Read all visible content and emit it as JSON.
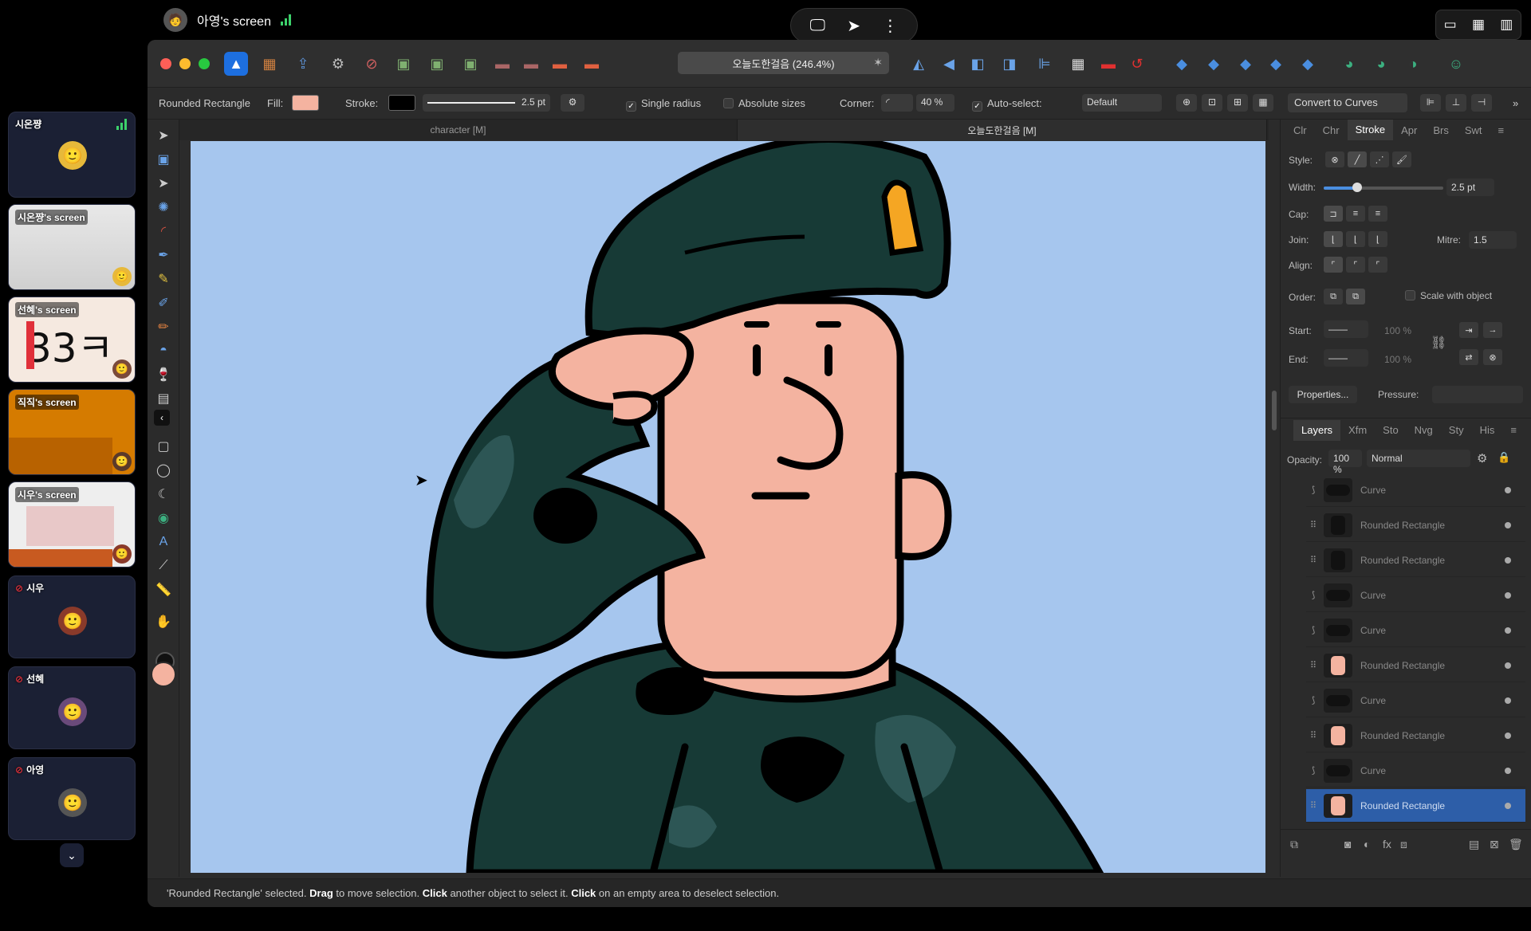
{
  "presenter": {
    "name": "아영's screen"
  },
  "share_controls": {
    "screen_icon": "monitor-icon",
    "pointer_icon": "cursor-icon",
    "more_icon": "more-vertical-icon"
  },
  "participants": [
    {
      "name": "시온쨩",
      "kind": "avatar"
    },
    {
      "name": "시온쨩's screen",
      "kind": "screen"
    },
    {
      "name": "선혜's screen",
      "kind": "screen",
      "screen_text": "33ㅋ"
    },
    {
      "name": "직직's screen",
      "kind": "screen"
    },
    {
      "name": "시우's screen",
      "kind": "screen"
    },
    {
      "name": "시우",
      "kind": "avatar",
      "muted": true
    },
    {
      "name": "선혜",
      "kind": "avatar",
      "muted": true
    },
    {
      "name": "아영",
      "kind": "avatar",
      "muted": true
    }
  ],
  "app": {
    "document_title": "오늘도한걸음 (246.4%)",
    "context": {
      "shape_name": "Rounded Rectangle",
      "fill_label": "Fill:",
      "fill_color": "#f4b3a0",
      "stroke_label": "Stroke:",
      "stroke_color": "#000000",
      "stroke_width": "2.5 pt",
      "single_radius": "Single radius",
      "absolute_sizes": "Absolute sizes",
      "corner_label": "Corner:",
      "corner_value": "40 %",
      "auto_select": "Auto-select:",
      "auto_select_value": "Default",
      "convert": "Convert to Curves"
    },
    "doc_tabs": [
      "character [M]",
      "오늘도한걸음 [M]"
    ],
    "stroke_panel": {
      "tabs": [
        "Clr",
        "Chr",
        "Stroke",
        "Apr",
        "Brs",
        "Swt"
      ],
      "active_tab": "Stroke",
      "style_label": "Style:",
      "width_label": "Width:",
      "width_value": "2.5 pt",
      "width_fraction": 0.28,
      "cap_label": "Cap:",
      "join_label": "Join:",
      "mitre_label": "Mitre:",
      "mitre_value": "1.5",
      "align_label": "Align:",
      "order_label": "Order:",
      "scale_with_object": "Scale with object",
      "start_label": "Start:",
      "end_label": "End:",
      "start_pct": "100 %",
      "end_pct": "100 %",
      "properties": "Properties...",
      "pressure": "Pressure:"
    },
    "layers_panel": {
      "tabs": [
        "Layers",
        "Xfm",
        "Sto",
        "Nvg",
        "Sty",
        "His"
      ],
      "active_tab": "Layers",
      "opacity_label": "Opacity:",
      "opacity_value": "100 %",
      "blend_mode": "Normal",
      "layers": [
        {
          "name": "Curve",
          "type": "curve",
          "thumb_color": "#111111"
        },
        {
          "name": "Rounded Rectangle",
          "type": "rect",
          "thumb_color": "#111111"
        },
        {
          "name": "Rounded Rectangle",
          "type": "rect",
          "thumb_color": "#111111"
        },
        {
          "name": "Curve",
          "type": "curve",
          "thumb_color": "#111111"
        },
        {
          "name": "Curve",
          "type": "curve",
          "thumb_color": "#111111"
        },
        {
          "name": "Rounded Rectangle",
          "type": "rect",
          "thumb_color": "#f4b3a0"
        },
        {
          "name": "Curve",
          "type": "curve",
          "thumb_color": "#111111"
        },
        {
          "name": "Rounded Rectangle",
          "type": "rect",
          "thumb_color": "#f4b3a0"
        },
        {
          "name": "Curve",
          "type": "curve",
          "thumb_color": "#111111"
        },
        {
          "name": "Rounded Rectangle",
          "type": "rect",
          "thumb_color": "#f4b3a0",
          "selected": true
        }
      ]
    },
    "status": {
      "part1": "'Rounded Rectangle' selected. ",
      "drag": "Drag",
      "part2": " to move selection. ",
      "click1": "Click",
      "part3": " another object to select it. ",
      "click2": "Click",
      "part4": " on an empty area to deselect selection."
    }
  },
  "colors": {
    "canvas_bg": "#a6c6ee",
    "uniform": "#173a36",
    "skin": "#f4b3a0",
    "badge": "#f5a623",
    "accent": "#2d5ea8"
  }
}
